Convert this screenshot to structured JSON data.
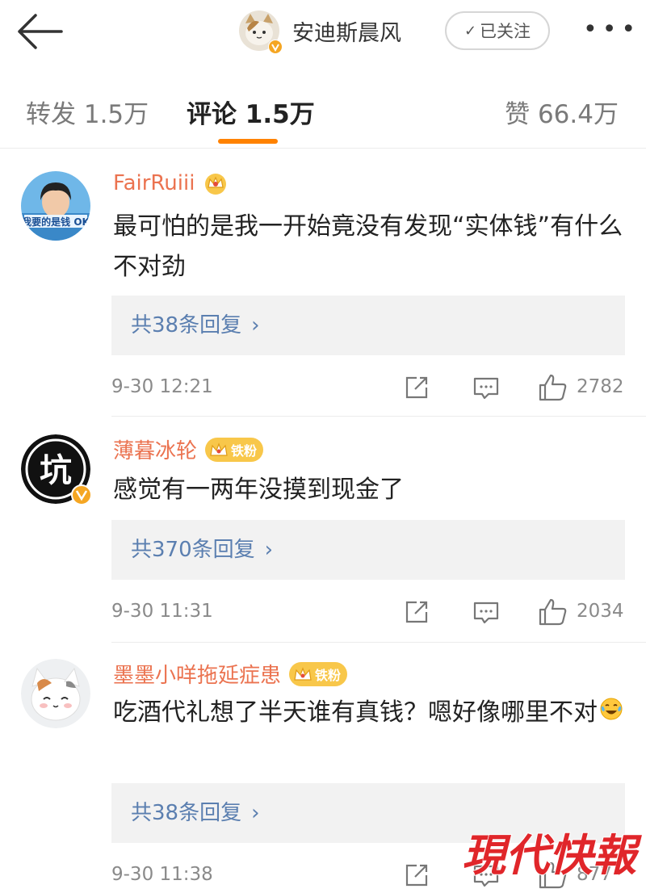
{
  "header": {
    "username": "安迪斯晨风",
    "follow_label": "已关注",
    "more_label": "•••"
  },
  "tabs": {
    "reposts": "转发 1.5万",
    "comments": "评论 1.5万",
    "likes": "赞 66.4万",
    "active": "comments"
  },
  "comments": [
    {
      "username": "FairRuiii",
      "fan_badge": "",
      "avatar_text": "我要的是钱 OK",
      "text": "最可怕的是我一开始竟没有发现“实体钱”有什么不对劲",
      "replies": "共38条回复",
      "time": "9-30 12:21",
      "likes": "2782"
    },
    {
      "username": "薄暮冰轮",
      "fan_badge": "铁粉",
      "avatar_text": "坑",
      "text": "感觉有一两年没摸到现金了",
      "replies": "共370条回复",
      "time": "9-30 11:31",
      "likes": "2034"
    },
    {
      "username": "墨墨小咩拖延症患",
      "fan_badge": "铁粉",
      "avatar_text": "",
      "text": "吃酒代礼想了半天谁有真钱？嗯好像哪里不对",
      "replies": "共38条回复",
      "time": "9-30 11:38",
      "likes": "877"
    }
  ],
  "watermark": "現代快報",
  "colors": {
    "accent": "#ff8200",
    "username": "#eb7350",
    "reply_link": "#5b7fb0",
    "badge": "#f8c74a",
    "watermark": "#e0262a"
  }
}
